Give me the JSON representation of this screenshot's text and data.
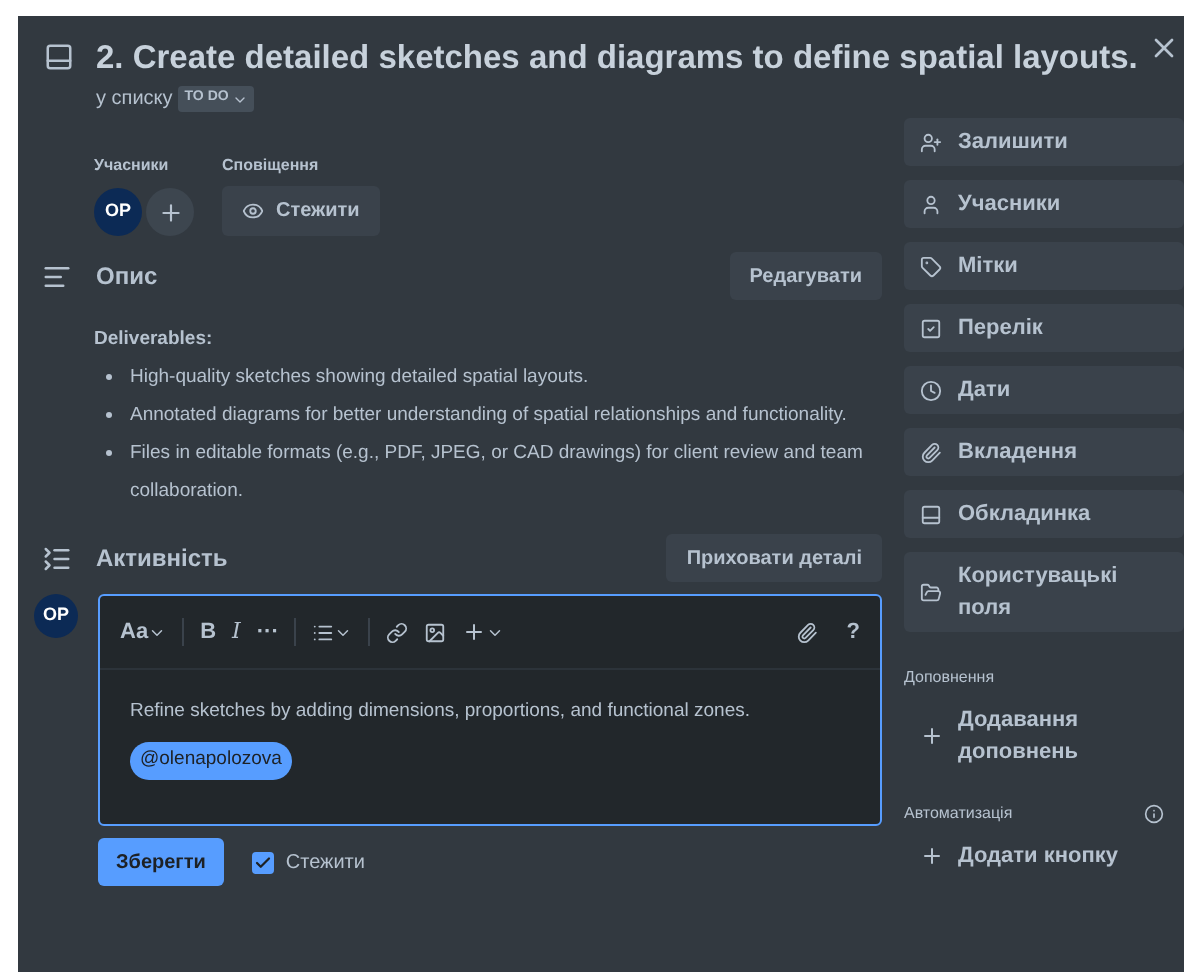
{
  "card": {
    "title": "2. Create detailed sketches and diagrams to define spatial layouts.",
    "list_prefix": "у списку",
    "list_name": "TO DO"
  },
  "members": {
    "label": "Учасники",
    "avatar": "OP"
  },
  "notifications": {
    "label": "Сповіщення",
    "watch_button": "Стежити"
  },
  "description": {
    "heading": "Опис",
    "edit_button": "Редагувати",
    "subheading": "Deliverables:",
    "bullets": [
      "High-quality sketches showing detailed spatial layouts.",
      "Annotated diagrams for better understanding of spatial relationships and functionality.",
      "Files in editable formats (e.g., PDF, JPEG, or CAD drawings) for client review and team collaboration."
    ]
  },
  "activity": {
    "heading": "Активність",
    "hide_button": "Приховати деталі",
    "avatar": "OP",
    "toolbar": {
      "text_style": "Aa",
      "bold": "B",
      "italic": "I",
      "more": "···",
      "help": "?"
    },
    "comment": "Refine sketches by adding dimensions, proportions, and functional zones.",
    "mention": "@olenapolozova",
    "save_button": "Зберегти",
    "watch": {
      "label": "Стежити",
      "checked": true
    }
  },
  "sidebar": {
    "actions": [
      {
        "label": "Залишити",
        "kind": "join"
      },
      {
        "label": "Учасники",
        "kind": "members"
      },
      {
        "label": "Мітки",
        "kind": "labels"
      },
      {
        "label": "Перелік",
        "kind": "checklist"
      },
      {
        "label": "Дати",
        "kind": "dates"
      },
      {
        "label": "Вкладення",
        "kind": "attachment"
      },
      {
        "label": "Обкладинка",
        "kind": "cover"
      },
      {
        "label": "Користувацькі поля",
        "kind": "fields"
      }
    ],
    "addons_label": "Доповнення",
    "add_addons": "Додавання доповнень",
    "automation_label": "Автоматизація",
    "add_button": "Додати кнопку"
  }
}
